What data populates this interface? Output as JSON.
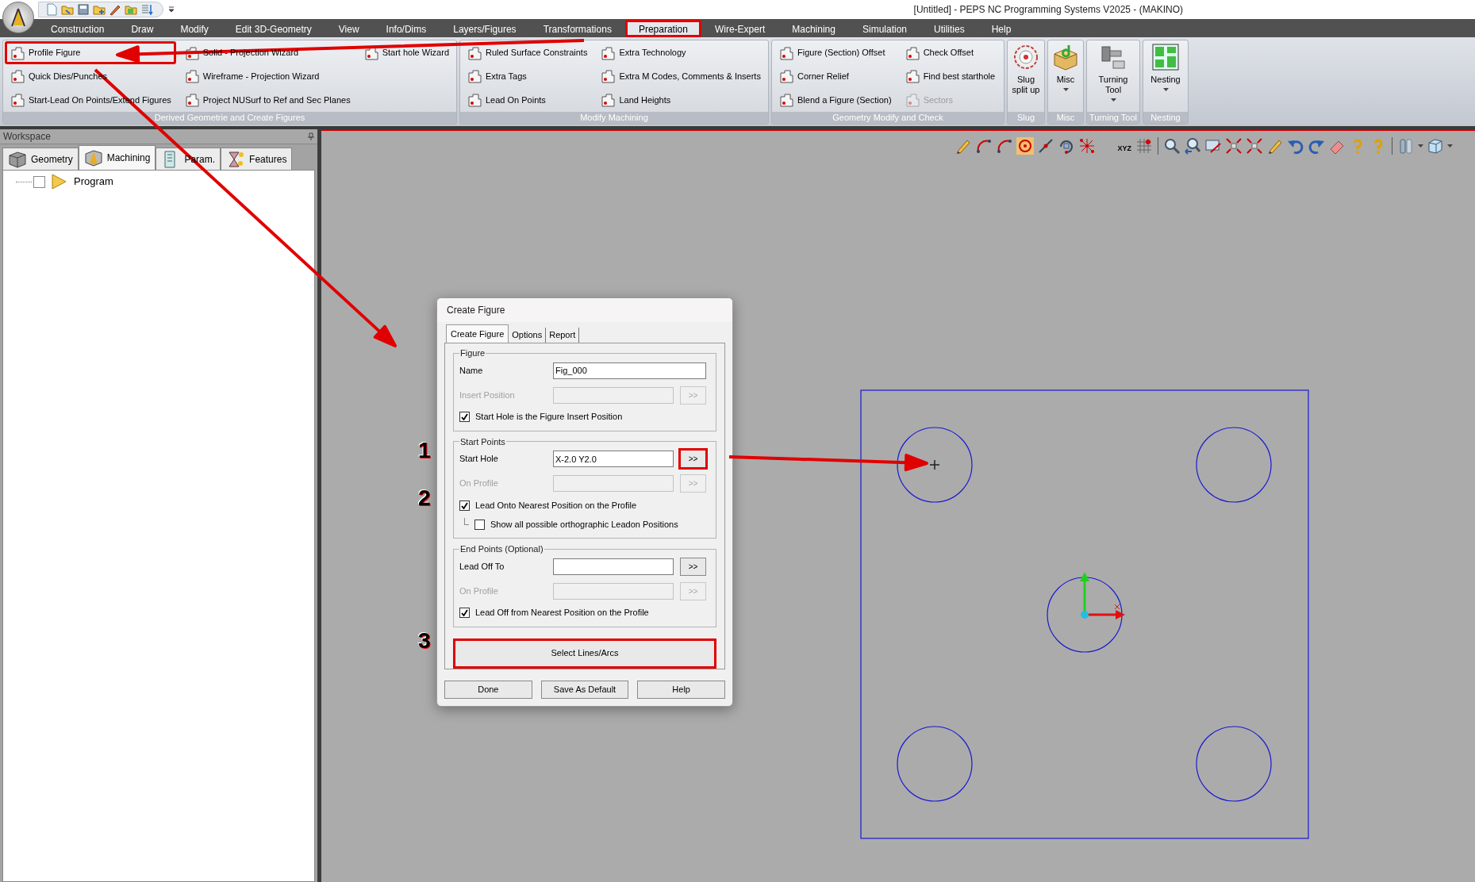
{
  "title_bar": {
    "title": "[Untitled] - PEPS NC Programming Systems V2025 - (MAKINO)"
  },
  "menu_tabs": [
    {
      "label": "Construction",
      "selected": false,
      "highlighted": false
    },
    {
      "label": "Draw",
      "selected": false,
      "highlighted": false
    },
    {
      "label": "Modify",
      "selected": false,
      "highlighted": false
    },
    {
      "label": "Edit 3D-Geometry",
      "selected": false,
      "highlighted": false
    },
    {
      "label": "View",
      "selected": false,
      "highlighted": false
    },
    {
      "label": "Info/Dims",
      "selected": false,
      "highlighted": false
    },
    {
      "label": "Layers/Figures",
      "selected": false,
      "highlighted": false
    },
    {
      "label": "Transformations",
      "selected": false,
      "highlighted": false
    },
    {
      "label": "Preparation",
      "selected": true,
      "highlighted": true
    },
    {
      "label": "Wire-Expert",
      "selected": false,
      "highlighted": false
    },
    {
      "label": "Machining",
      "selected": false,
      "highlighted": false
    },
    {
      "label": "Simulation",
      "selected": false,
      "highlighted": false
    },
    {
      "label": "Utilities",
      "selected": false,
      "highlighted": false
    },
    {
      "label": "Help",
      "selected": false,
      "highlighted": false
    }
  ],
  "ribbon_groups": [
    {
      "label": "Derived Geometrie and Create Figures",
      "kind": "list",
      "items": [
        {
          "label": "Profile Figure",
          "disabled": false,
          "highlighted": true
        },
        {
          "label": "Quick Dies/Punches",
          "disabled": false,
          "highlighted": false
        },
        {
          "label": "Start-Lead On Points/Extend Figures",
          "disabled": false,
          "highlighted": false
        },
        {
          "label": "Solid - Projection Wizard",
          "disabled": false,
          "highlighted": false
        },
        {
          "label": "Wireframe - Projection Wizard",
          "disabled": false,
          "highlighted": false
        },
        {
          "label": "Project NUSurf to Ref and Sec Planes",
          "disabled": false,
          "highlighted": false
        },
        {
          "label": "Start hole Wizard",
          "disabled": false,
          "highlighted": false
        }
      ]
    },
    {
      "label": "Modify Machining",
      "kind": "list",
      "items": [
        {
          "label": "Ruled Surface Constraints",
          "disabled": false,
          "highlighted": false
        },
        {
          "label": "Extra Tags",
          "disabled": false,
          "highlighted": false
        },
        {
          "label": "Lead On Points",
          "disabled": false,
          "highlighted": false
        },
        {
          "label": "Extra Technology",
          "disabled": false,
          "highlighted": false
        },
        {
          "label": "Extra M Codes, Comments & Inserts",
          "disabled": false,
          "highlighted": false
        },
        {
          "label": "Land Heights",
          "disabled": false,
          "highlighted": false
        }
      ]
    },
    {
      "label": "Geometry Modify and Check",
      "kind": "list",
      "items": [
        {
          "label": "Figure (Section) Offset",
          "disabled": false,
          "highlighted": false
        },
        {
          "label": "Corner Relief",
          "disabled": false,
          "highlighted": false
        },
        {
          "label": "Blend a Figure (Section)",
          "disabled": false,
          "highlighted": false
        },
        {
          "label": "Check Offset",
          "disabled": false,
          "highlighted": false
        },
        {
          "label": "Find best starthole",
          "disabled": false,
          "highlighted": false
        },
        {
          "label": "Sectors",
          "disabled": true,
          "highlighted": false
        }
      ]
    },
    {
      "label": "Slug",
      "kind": "large",
      "items": [
        {
          "label": "Slug split up",
          "dropdown": false
        }
      ]
    },
    {
      "label": "Misc",
      "kind": "large",
      "items": [
        {
          "label": "Misc",
          "dropdown": true
        }
      ]
    },
    {
      "label": "Turning Tool",
      "kind": "large",
      "items": [
        {
          "label": "Turning Tool",
          "dropdown": true
        }
      ]
    },
    {
      "label": "Nesting",
      "kind": "large",
      "items": [
        {
          "label": "Nesting",
          "dropdown": true
        }
      ]
    }
  ],
  "workspace": {
    "title": "Workspace",
    "tabs": [
      {
        "label": "Geometry",
        "selected": false
      },
      {
        "label": "Machining",
        "selected": true
      },
      {
        "label": "Param.",
        "selected": false
      },
      {
        "label": "Features",
        "selected": false
      }
    ],
    "tree": [
      {
        "label": "Program",
        "checked": false
      }
    ]
  },
  "canvas_toolbar": {
    "coordinate_button": "XYZ"
  },
  "dialog": {
    "title": "Create Figure",
    "tabs": [
      {
        "label": "Create Figure",
        "selected": true
      },
      {
        "label": "Options",
        "selected": false
      },
      {
        "label": "Report",
        "selected": false
      }
    ],
    "sections": [
      {
        "title": "Figure",
        "rows": [
          {
            "kind": "field",
            "label": "Name",
            "value": "Fig_000",
            "disabled": false,
            "highlighted": false
          },
          {
            "kind": "field",
            "label": "Insert Position",
            "disabled": true,
            "button": ">>",
            "highlighted": false
          },
          {
            "kind": "checkbox",
            "label": "Start Hole is the Figure Insert Position",
            "checked": true,
            "highlighted": false
          }
        ]
      },
      {
        "title": "Start Points",
        "rows": [
          {
            "kind": "field",
            "label": "Start Hole",
            "value": "X-2.0 Y2.0",
            "disabled": false,
            "button": ">>",
            "highlighted": true
          },
          {
            "kind": "field",
            "label": "On Profile",
            "disabled": true,
            "button": ">>",
            "highlighted": false
          },
          {
            "kind": "checkbox",
            "label": "Lead Onto Nearest Position on the Profile",
            "checked": true,
            "highlighted": false,
            "children": [
              {
                "kind": "checkbox",
                "label": "Show all possible orthographic Leadon Positions",
                "checked": false,
                "highlighted": false
              }
            ]
          }
        ]
      },
      {
        "title": "End Points (Optional)",
        "rows": [
          {
            "kind": "field",
            "label": "Lead Off To",
            "disabled": false,
            "button": ">>",
            "highlighted": false
          },
          {
            "kind": "field",
            "label": "On Profile",
            "disabled": true,
            "button": ">>",
            "highlighted": false
          },
          {
            "kind": "checkbox",
            "label": "Lead Off from Nearest Position on the Profile",
            "checked": true,
            "highlighted": false
          }
        ]
      }
    ],
    "select_button": {
      "label": "Select Lines/Arcs",
      "highlighted": true
    },
    "footer_buttons": [
      "Done",
      "Save As Default",
      "Help"
    ]
  },
  "annotations": {
    "markers": [
      "1",
      "2",
      "3"
    ]
  }
}
